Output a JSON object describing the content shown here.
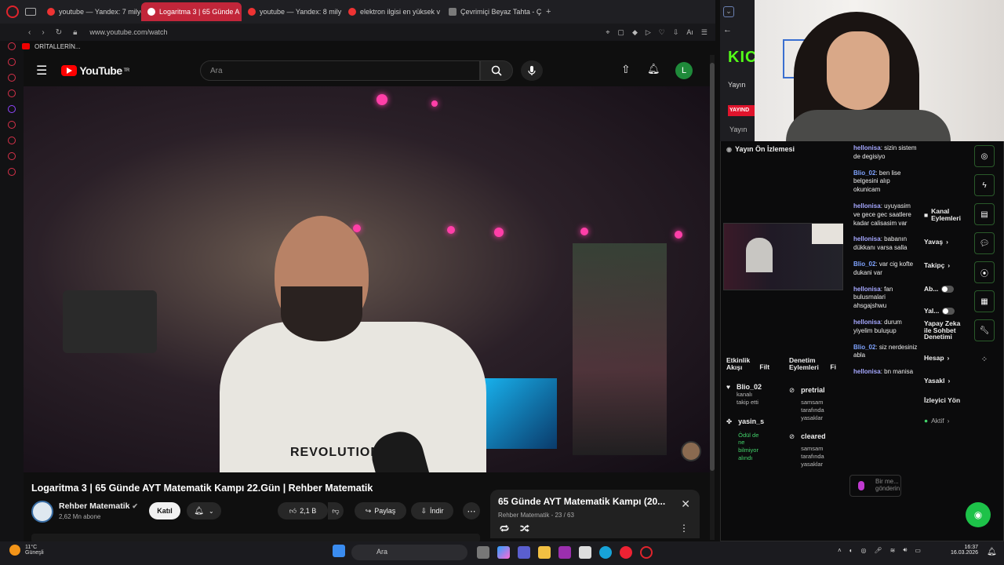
{
  "browser": {
    "tabs": [
      {
        "label": "youtube — Yandex: 7 milyo"
      },
      {
        "label": "Logaritma 3 | 65 Günde A"
      },
      {
        "label": "youtube — Yandex: 8 mily"
      },
      {
        "label": "elektron ilgisi en yüksek v"
      },
      {
        "label": "Çevrimiçi Beyaz Tahta - Ç"
      }
    ],
    "new_tab": "+",
    "url": "www.youtube.com/watch",
    "bookmark": "ORİTALLERİN..."
  },
  "youtube": {
    "logo": "YouTube",
    "region": "TR",
    "search_placeholder": "Ara",
    "avatar_letter": "L",
    "video_overlay_text": "REVOLUTION",
    "video_title": "Logaritma 3 | 65 Günde AYT Matematik Kampı 22.Gün | Rehber Matematik",
    "channel_name": "Rehber Matematik",
    "subscribers": "2,62 Mn abone",
    "join_label": "Katıl",
    "likes": "2,1 B",
    "share_label": "Paylaş",
    "download_label": "İndir",
    "playlist": {
      "title": "65 Günde AYT Matematik Kampı (20...",
      "subtitle": "Rehber Matematik - 23 / 63"
    }
  },
  "stream": {
    "logo": "KIC",
    "yayin": "Yayın",
    "live_badge": "YAYIND",
    "yayin2": "Yayın",
    "preview_title": "Yayın Ön İzlemesi",
    "chat": [
      {
        "user": "hellonisa",
        "text": "sizin sistem de degisiyo"
      },
      {
        "user": "Blio_02",
        "text": "ben lise belgesini alıp okunicam"
      },
      {
        "user": "hellonisa",
        "text": "uyuyasim ve gece gec saatlere kadar calisasim var"
      },
      {
        "user": "hellonisa",
        "text": "babanın dükkanı varsa salla"
      },
      {
        "user": "Blio_02",
        "text": "var cig kofte dukani var"
      },
      {
        "user": "hellonisa",
        "text": "fan bulusmalari ahsgajshwu"
      },
      {
        "user": "hellonisa",
        "text": "durum yiyelim buluşup"
      },
      {
        "user": "Blio_02",
        "text": "siz nerdesiniz abla"
      },
      {
        "user": "hellonisa",
        "text": "bn manisa"
      }
    ],
    "chat_input_placeholder": "Bir me... gönderin",
    "actions": {
      "header": "Kanal Eylemleri",
      "items": [
        "Yavaş",
        "Takipç",
        "Ab...",
        "Yal...",
        "Yapay Zeka ile Sohbet Denetimi",
        "Hesap",
        "Yasakl",
        "İzleyici Yön",
        "Aktif"
      ]
    },
    "activity": {
      "header": "Etkinlik Akışı",
      "filter": "Filt",
      "items": [
        {
          "user": "Blio_02",
          "sub": "kanalı takip etti"
        },
        {
          "user": "yasin_s",
          "sub": "Ödül de ne bilmiyor alındı"
        }
      ]
    },
    "moderation": {
      "header": "Denetim Eylemleri",
      "filter": "Fi",
      "items": [
        {
          "user": "pretrial",
          "sub": "samsam tarafında yasaklar"
        },
        {
          "user": "cleared",
          "sub": "samsam tarafında yasaklar"
        }
      ]
    }
  },
  "taskbar": {
    "weather_temp": "11°C",
    "weather_desc": "Güneşli",
    "search": "Ara",
    "time": "16:37",
    "date": "16.03.2026"
  },
  "colors": {
    "accent": "#c2263a",
    "kick": "#53fc18",
    "yt_red": "#ff0000"
  }
}
